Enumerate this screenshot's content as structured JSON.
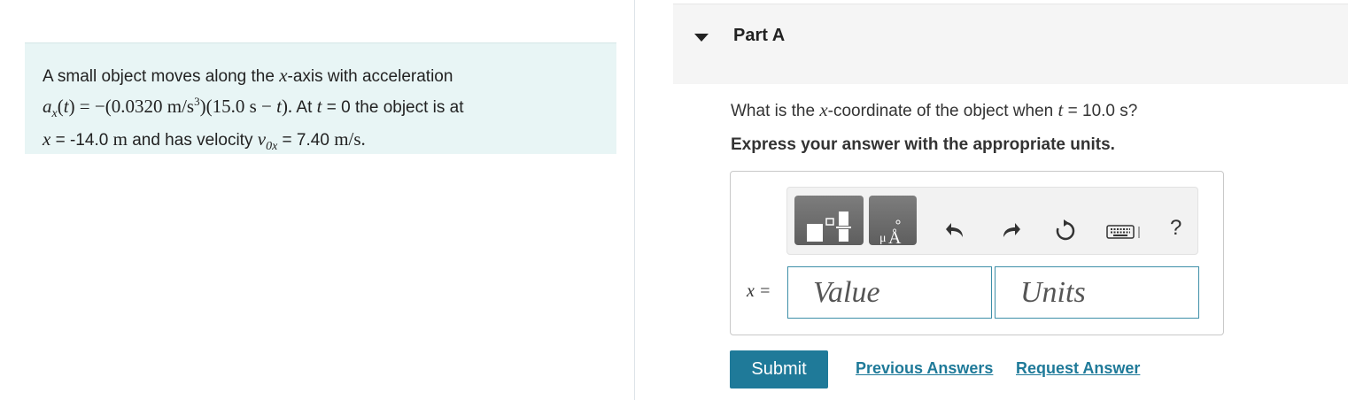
{
  "problem": {
    "line1_text": "A small object moves along the ",
    "line1_var": "x",
    "line1_end": "-axis with acceleration",
    "line2_expr": "a_x(t) = −(0.0320 m/s³)(15.0 s − t).",
    "line2_mid": " At ",
    "line2_t": "t",
    "line2_end": " = 0 the object is at",
    "line3_x": "x",
    "line3_val": " = -14.0 ",
    "line3_unit": "m",
    "line3_mid": " and has velocity ",
    "line3_v": "v",
    "line3_sub": "0x",
    "line3_vval": " = 7.40 ",
    "line3_vunit": "m/s."
  },
  "part": {
    "title": "Part A"
  },
  "question": {
    "prefix": "What is the ",
    "var": "x",
    "middle": "-coordinate of the object when ",
    "t": "t",
    "suffix": " = 10.0 s?",
    "instruction": "Express your answer with the appropriate units."
  },
  "toolbar": {
    "icons": [
      "templates-icon",
      "units-icon",
      "undo-icon",
      "redo-icon",
      "reset-icon",
      "keyboard-icon",
      "help-icon"
    ],
    "help_label": "?"
  },
  "answer": {
    "label": "x =",
    "value_placeholder": "Value",
    "units_placeholder": "Units"
  },
  "actions": {
    "submit_label": "Submit",
    "previous_label": "Previous Answers",
    "request_label": "Request Answer"
  }
}
